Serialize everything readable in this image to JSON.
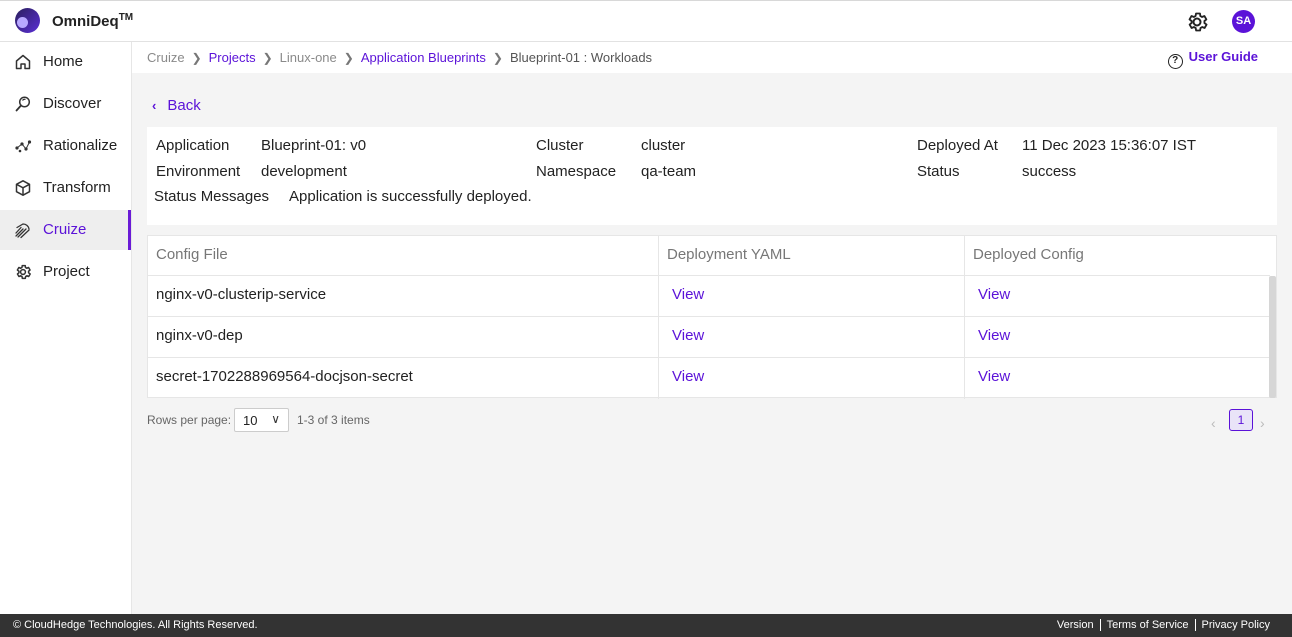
{
  "header": {
    "brand": "OmniDeq",
    "brand_tm": "TM",
    "avatar": "SA"
  },
  "sidebar": {
    "items": [
      {
        "label": "Home",
        "icon": "home-icon"
      },
      {
        "label": "Discover",
        "icon": "discover-icon"
      },
      {
        "label": "Rationalize",
        "icon": "rationalize-icon"
      },
      {
        "label": "Transform",
        "icon": "cube-icon"
      },
      {
        "label": "Cruize",
        "icon": "cruize-icon",
        "active": true
      },
      {
        "label": "Project",
        "icon": "gear-icon"
      }
    ]
  },
  "breadcrumb": {
    "items": [
      "Cruize",
      "Projects",
      "Linux-one",
      "Application Blueprints",
      "Blueprint-01 : Workloads"
    ],
    "user_guide": "User Guide"
  },
  "back_label": "Back",
  "details": {
    "application_label": "Application",
    "application_value": "Blueprint-01: v0",
    "environment_label": "Environment",
    "environment_value": "development",
    "cluster_label": "Cluster",
    "cluster_value": "cluster",
    "namespace_label": "Namespace",
    "namespace_value": "qa-team",
    "deployed_at_label": "Deployed At",
    "deployed_at_value": "11 Dec 2023 15:36:07 IST",
    "status_label": "Status",
    "status_value": "success",
    "status_messages_label": "Status Messages",
    "status_messages_value": "Application is successfully deployed."
  },
  "table": {
    "headers": [
      "Config File",
      "Deployment YAML",
      "Deployed Config"
    ],
    "rows": [
      {
        "file": "nginx-v0-clusterip-service",
        "yaml": "View",
        "config": "View"
      },
      {
        "file": "nginx-v0-dep",
        "yaml": "View",
        "config": "View"
      },
      {
        "file": "secret-1702288969564-docjson-secret",
        "yaml": "View",
        "config": "View"
      }
    ]
  },
  "pagination": {
    "rows_per_page_label": "Rows per page:",
    "rows_per_page_value": "10",
    "range": "1-3 of 3 items",
    "current_page": "1"
  },
  "footer": {
    "copyright": "© CloudHedge Technologies. All Rights Reserved.",
    "links": [
      "Version",
      "Terms of Service",
      "Privacy Policy"
    ]
  },
  "colors": {
    "accent": "#5b12d8",
    "footer": "#333333"
  }
}
